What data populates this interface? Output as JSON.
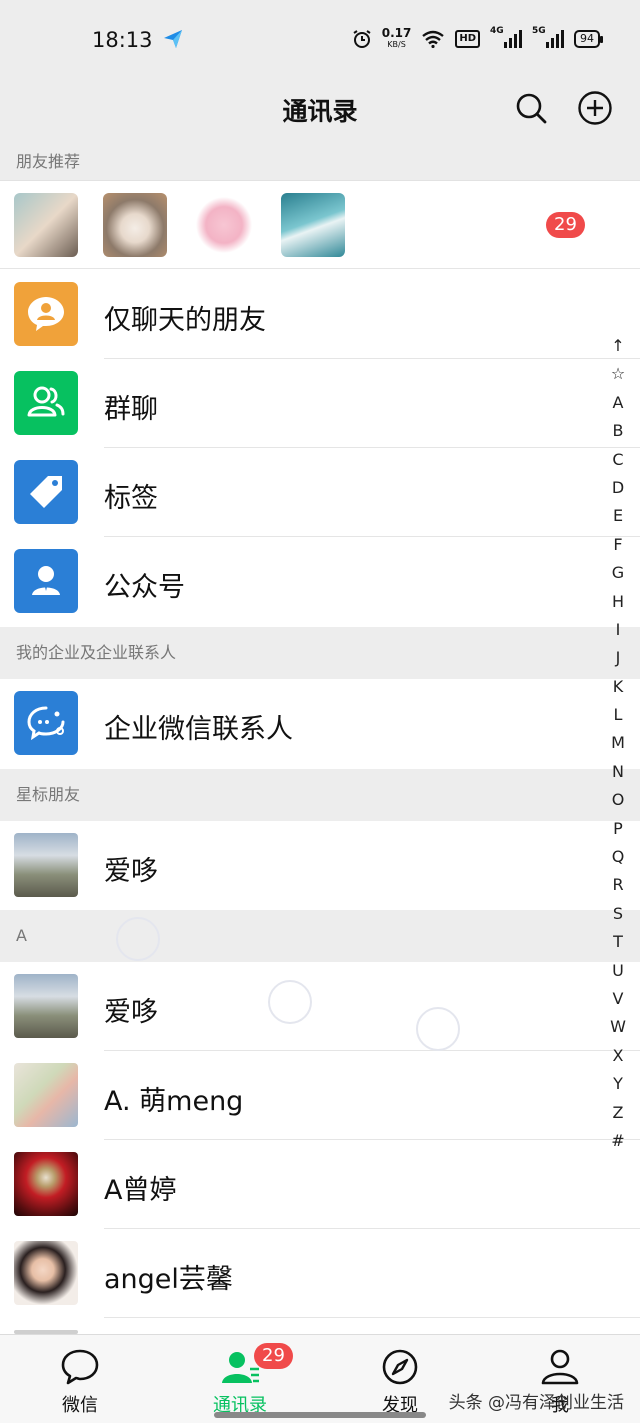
{
  "status_bar": {
    "time": "18:13",
    "net_speed": "0.17",
    "net_unit": "KB/S",
    "hd": "HD",
    "sig1": "4G",
    "sig2": "5G",
    "battery": "94"
  },
  "header": {
    "title": "通讯录"
  },
  "sections": {
    "friends_rec": "朋友推荐",
    "enterprise": "我的企业及企业联系人",
    "starred": "星标朋友",
    "letter_a": "A"
  },
  "recommend_badge": "29",
  "menu_items": [
    {
      "label": "仅聊天的朋友",
      "color": "#f0a23a",
      "icon": "chat-bubble-icon"
    },
    {
      "label": "群聊",
      "color": "#07c160",
      "icon": "group-icon"
    },
    {
      "label": "标签",
      "color": "#2b7fd6",
      "icon": "tag-icon"
    },
    {
      "label": "公众号",
      "color": "#2b7fd6",
      "icon": "official-account-icon"
    }
  ],
  "enterprise_item": {
    "label": "企业微信联系人",
    "color": "#2b7fd6",
    "icon": "wecom-icon"
  },
  "starred_contacts": [
    {
      "name": "爱哆"
    }
  ],
  "contacts_a": [
    {
      "name": "爱哆"
    },
    {
      "name": "A. 萌meng"
    },
    {
      "name": "A曾婷"
    },
    {
      "name": "angel芸馨"
    }
  ],
  "index_letters": [
    "↑",
    "☆",
    "A",
    "B",
    "C",
    "D",
    "E",
    "F",
    "G",
    "H",
    "I",
    "J",
    "K",
    "L",
    "M",
    "N",
    "O",
    "P",
    "Q",
    "R",
    "S",
    "T",
    "U",
    "V",
    "W",
    "X",
    "Y",
    "Z",
    "#"
  ],
  "tabs": [
    {
      "label": "微信",
      "icon": "chat-icon",
      "active": false
    },
    {
      "label": "通讯录",
      "icon": "contacts-icon",
      "active": true,
      "badge": "29"
    },
    {
      "label": "发现",
      "icon": "compass-icon",
      "active": false
    },
    {
      "label": "我",
      "icon": "person-icon",
      "active": false
    }
  ],
  "watermark": "头条 @冯有泽创业生活",
  "colors": {
    "accent": "#07c160",
    "badge": "#f04a4a"
  }
}
